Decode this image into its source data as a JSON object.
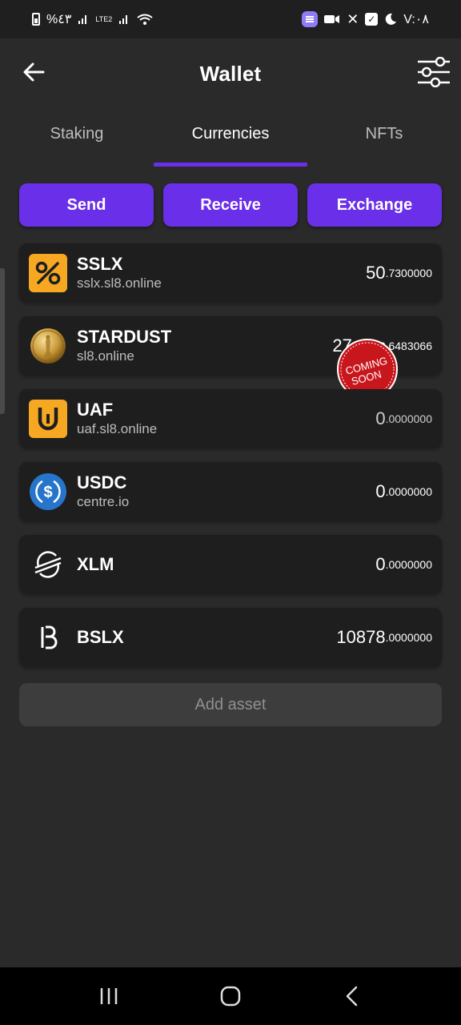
{
  "status_bar": {
    "battery_text": "%٤٣",
    "network_label": "LTE2",
    "time": "V:٠٨"
  },
  "header": {
    "title": "Wallet"
  },
  "tabs": [
    {
      "label": "Staking",
      "active": false
    },
    {
      "label": "Currencies",
      "active": true
    },
    {
      "label": "NFTs",
      "active": false
    }
  ],
  "actions": {
    "send": "Send",
    "receive": "Receive",
    "exchange": "Exchange"
  },
  "assets": [
    {
      "name": "SSLX",
      "domain": "sslx.sl8.online",
      "balance_int": "50",
      "balance_dec": ".7300000",
      "icon": "percent-icon"
    },
    {
      "name": "STARDUST",
      "domain": "sl8.online",
      "balance_int": "27",
      "balance_dec": "2.6483066",
      "icon": "gold-coin-icon"
    },
    {
      "name": "UAF",
      "domain": "uaf.sl8.online",
      "balance_int": "0",
      "balance_dec": ".0000000",
      "icon": "magnet-icon"
    },
    {
      "name": "USDC",
      "domain": "centre.io",
      "balance_int": "0",
      "balance_dec": ".0000000",
      "icon": "usdc-icon"
    },
    {
      "name": "XLM",
      "domain": "",
      "balance_int": "0",
      "balance_dec": ".0000000",
      "icon": "stellar-icon"
    },
    {
      "name": "BSLX",
      "domain": "",
      "balance_int": "10878",
      "balance_dec": ".0000000",
      "icon": "bslx-icon"
    }
  ],
  "coming_soon": {
    "line1": "COMING",
    "line2": "SOON"
  },
  "add_asset": "Add asset",
  "colors": {
    "accent": "#6a2fe8",
    "background": "#2a2a2b",
    "card": "#1e1e1f",
    "sslx_yellow": "#f6a823",
    "usdc_blue": "#2775ca"
  }
}
